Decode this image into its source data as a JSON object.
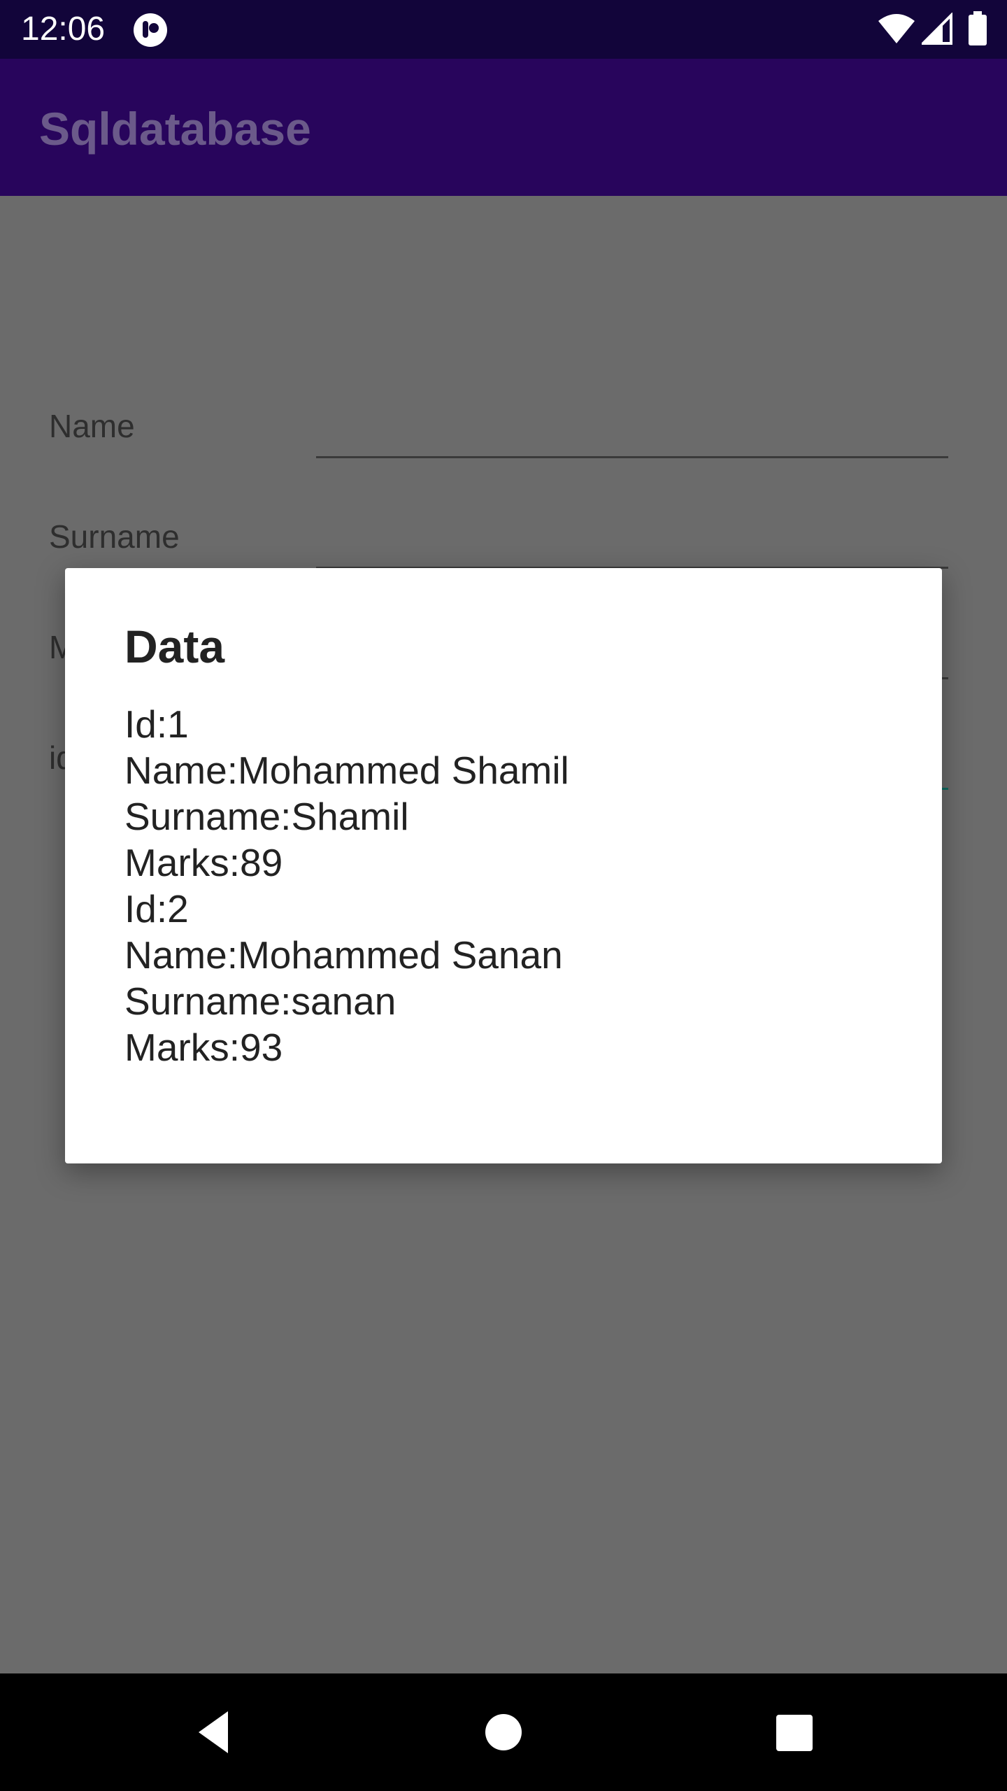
{
  "status_bar": {
    "time": "12:06",
    "icons": [
      "app-notification-icon",
      "wifi-icon",
      "signal-icon",
      "battery-icon"
    ]
  },
  "app_bar": {
    "title": "Sqldatabase"
  },
  "form": {
    "name_label": "Name",
    "surname_label": "Surname",
    "marks_label": "M",
    "id_label": "id"
  },
  "dialog": {
    "title": "Data",
    "lines": [
      "Id:1",
      "Name:Mohammed Shamil",
      "Surname:Shamil",
      "Marks:89",
      "Id:2",
      "Name:Mohammed Sanan",
      "Surname:sanan",
      "Marks:93"
    ]
  },
  "nav_bar": {
    "icons": [
      "back-icon",
      "home-icon",
      "recents-icon"
    ]
  },
  "colors": {
    "status_bar": "#12053a",
    "app_bar": "#28055c",
    "scrim_background": "#6b6b6b",
    "accent_line": "#0e6b61"
  }
}
